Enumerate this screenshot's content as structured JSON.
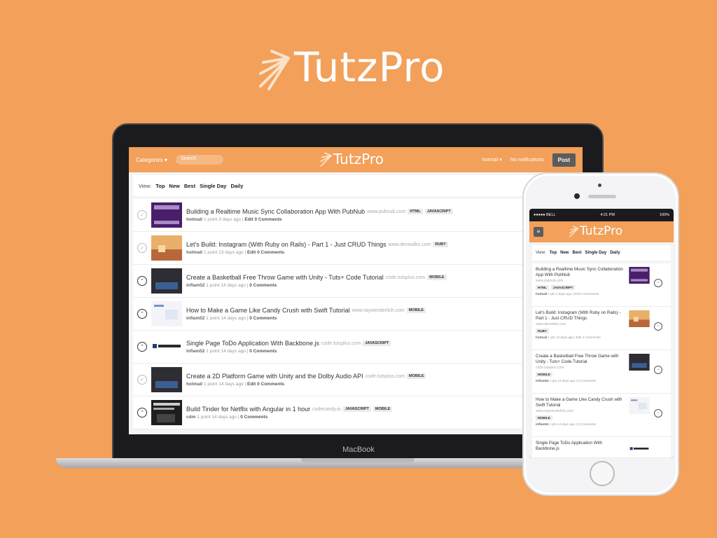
{
  "brand": {
    "name": "TutzPro"
  },
  "laptop": {
    "brand_label": "MacBook",
    "topbar": {
      "categories_label": "Categories ▾",
      "search_placeholder": "Search",
      "user_label": "hotmail ▾",
      "notifications_label": "No notifications",
      "post_label": "Post"
    },
    "view_label": "View:",
    "views": [
      "Top",
      "New",
      "Best",
      "Single Day",
      "Daily"
    ],
    "posts": [
      {
        "title": "Building a Realtime Music Sync Collaboration App With PubNub",
        "domain": "www.pubnub.com",
        "tags": [
          "HTML",
          "JAVASCRIPT"
        ],
        "author": "hotmail",
        "meta": "1 point 3 days ago",
        "edit": "Edit",
        "comments": "0 Comments",
        "voted": false
      },
      {
        "title": "Let's Build: Instagram (With Ruby on Rails) - Part 1 - Just CRUD Things",
        "domain": "www.devwalks.com",
        "tags": [
          "RUBY"
        ],
        "author": "hotmail",
        "meta": "1 point 13 days ago",
        "edit": "Edit",
        "comments": "0 Comments",
        "voted": false
      },
      {
        "title": "Create a Basketball Free Throw Game with Unity - Tuts+ Code Tutorial",
        "domain": "code.tutsplus.com",
        "tags": [
          "MOBILE"
        ],
        "author": "inflam52",
        "meta": "1 point 14 days ago",
        "edit": "",
        "comments": "0 Comments",
        "voted": true
      },
      {
        "title": "How to Make a Game Like Candy Crush with Swift Tutorial",
        "domain": "www.raywenderlich.com",
        "tags": [
          "MOBILE"
        ],
        "author": "inflam52",
        "meta": "1 point 14 days ago",
        "edit": "",
        "comments": "0 Comments",
        "voted": true
      },
      {
        "title": "Single Page ToDo Application With Backbone.js",
        "domain": "code.tutsplus.com",
        "tags": [
          "JAVASCRIPT"
        ],
        "author": "inflam52",
        "meta": "1 point 14 days ago",
        "edit": "",
        "comments": "0 Comments",
        "voted": true
      },
      {
        "title": "Create a 2D Platform Game with Unity and the Dolby Audio API",
        "domain": "code.tutsplus.com",
        "tags": [
          "MOBILE"
        ],
        "author": "hotmail",
        "meta": "1 point 14 days ago",
        "edit": "Edit",
        "comments": "0 Comments",
        "voted": false
      },
      {
        "title": "Build Tinder for Netflix with Angular in 1 hour",
        "domain": "codecandy.io",
        "tags": [
          "JAVASCRIPT",
          "MOBILE"
        ],
        "author": "cdm",
        "meta": "1 point 14 days ago",
        "edit": "",
        "comments": "0 Comments",
        "voted": true
      }
    ]
  },
  "phone": {
    "status": {
      "carrier": "●●●●● BELL",
      "time": "4:21 PM",
      "battery": "100%"
    },
    "menu_icon": "≡",
    "view_label": "View:",
    "views": [
      "Top",
      "New",
      "Best",
      "Single Day",
      "Daily"
    ],
    "posts": [
      {
        "title": "Building a Realtime Music Sync Collaboration App With PubNub",
        "domain": "www.pubnub.com",
        "tags": [
          "HTML",
          "JAVASCRIPT"
        ],
        "author": "hotmail",
        "meta": "1 pts 3 days ago",
        "edit": "Edit",
        "comments": "0 Comments"
      },
      {
        "title": "Let's Build: Instagram (With Ruby on Rails) - Part 1 - Just CRUD Things",
        "domain": "www.devwalks.com",
        "tags": [
          "RUBY"
        ],
        "author": "hotmail",
        "meta": "1 pts 13 days ago",
        "edit": "Edit",
        "comments": "0 Comments"
      },
      {
        "title": "Create a Basketball Free Throw Game with Unity - Tuts+ Code Tutorial",
        "domain": "code.tutsplus.com",
        "tags": [
          "MOBILE"
        ],
        "author": "inflam52",
        "meta": "1 pts 14 days ago",
        "edit": "",
        "comments": "0 Comments"
      },
      {
        "title": "How to Make a Game Like Candy Crush with Swift Tutorial",
        "domain": "www.raywenderlich.com",
        "tags": [
          "MOBILE"
        ],
        "author": "inflam52",
        "meta": "1 pts 14 days ago",
        "edit": "",
        "comments": "0 Comments"
      },
      {
        "title": "Single Page ToDo Application With Backbone.js",
        "domain": "",
        "tags": [],
        "author": "",
        "meta": "",
        "edit": "",
        "comments": ""
      }
    ]
  },
  "colors": {
    "brand_orange": "#f2a05a",
    "dark_button": "#5c5c5c"
  }
}
